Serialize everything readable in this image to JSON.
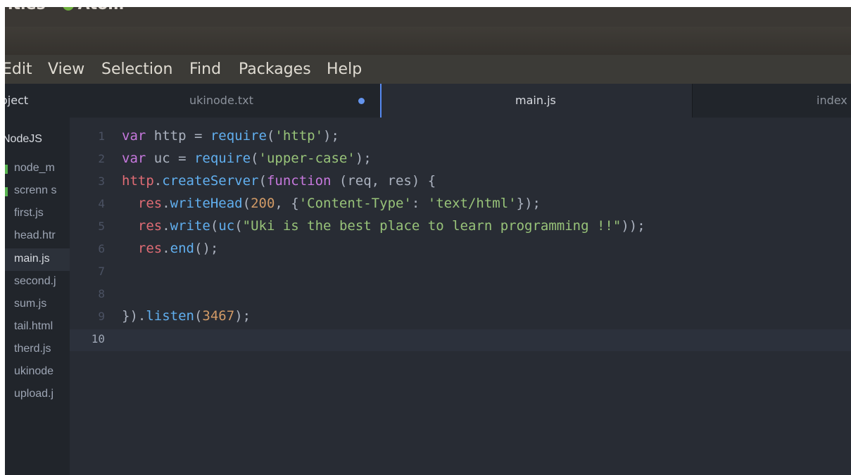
{
  "system": {
    "text_left": "ities",
    "app_name": "Atom"
  },
  "menu": [
    "Edit",
    "View",
    "Selection",
    "Find",
    "Packages",
    "Help"
  ],
  "tree_tab": "oject",
  "tabs": [
    {
      "label": "ukinode.txt",
      "modified": true
    },
    {
      "label": "main.js",
      "active": true
    },
    {
      "label": "index"
    }
  ],
  "tree": {
    "root": "NodeJS",
    "items": [
      {
        "label": "node_m",
        "folder": true
      },
      {
        "label": "screnn s",
        "folder": true
      },
      {
        "label": "first.js"
      },
      {
        "label": "head.htr"
      },
      {
        "label": "main.js",
        "selected": true
      },
      {
        "label": "second.j"
      },
      {
        "label": "sum.js"
      },
      {
        "label": "tail.html"
      },
      {
        "label": "therd.js"
      },
      {
        "label": "ukinode"
      },
      {
        "label": "upload.j"
      }
    ]
  },
  "editor": {
    "line_numbers": [
      "1",
      "2",
      "3",
      "4",
      "5",
      "6",
      "7",
      "8",
      "9",
      "10"
    ],
    "cursor_line": "10",
    "code_lines": [
      "var http = require('http');",
      "var uc = require('upper-case');",
      "http.createServer(function (req, res) {",
      "  res.writeHead(200, {'Content-Type': 'text/html'});",
      "  res.write(uc(\"Uki is the best place to learn programming !!\"));",
      "  res.end();",
      "",
      "",
      "}).listen(3467);",
      ""
    ]
  },
  "colors": {
    "keyword": "#c678dd",
    "function": "#61afef",
    "identifier": "#e06c75",
    "string": "#98c379",
    "number": "#d19a66",
    "background": "#282c34"
  }
}
